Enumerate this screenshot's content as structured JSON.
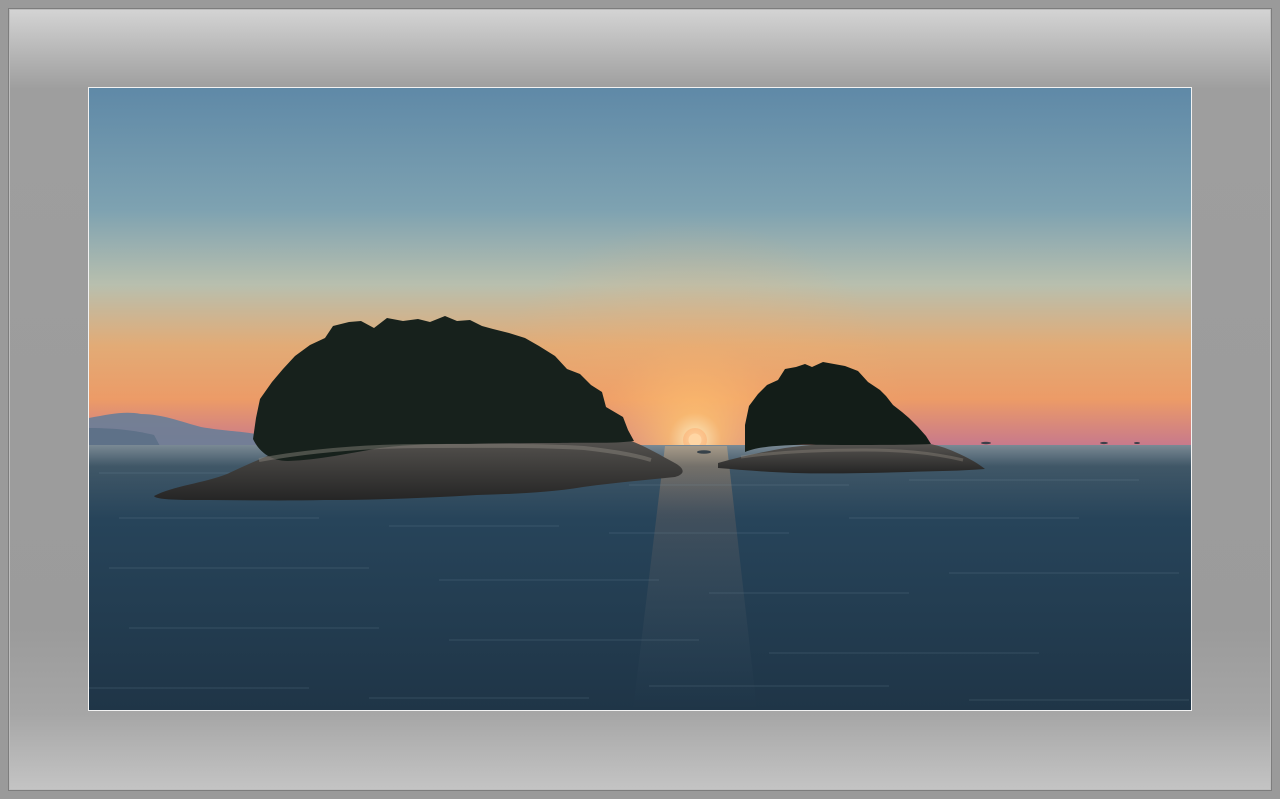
{
  "scene": {
    "subject": "sunset-over-sea-with-two-islands",
    "colors": {
      "sky_top": "#5f89a7",
      "sky_horizon": "#e9a86c",
      "sun": "#ffd07a",
      "sea": "#223a4f",
      "island": "#15211b",
      "frame": "#9c9c9c"
    }
  }
}
